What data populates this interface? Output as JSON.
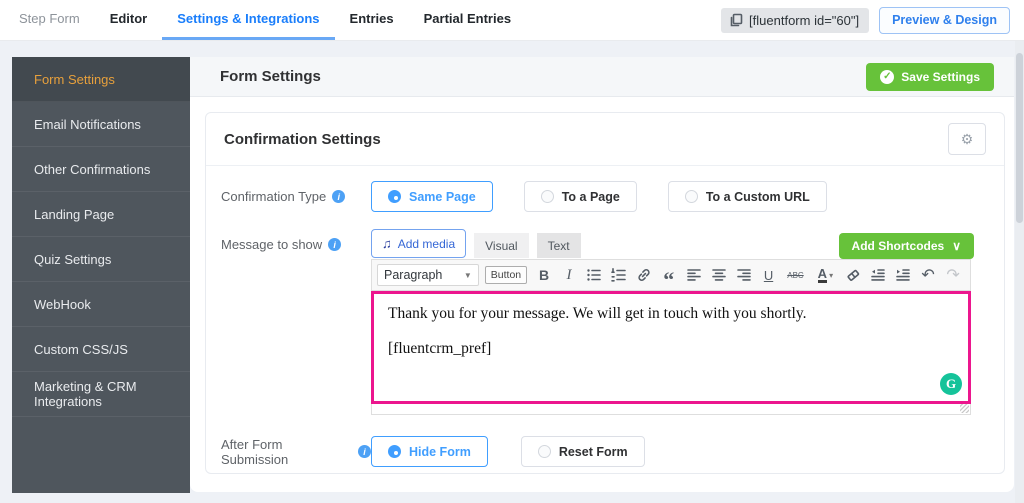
{
  "topbar": {
    "tabs": [
      {
        "label": "Step Form",
        "active": false
      },
      {
        "label": "Editor",
        "active": false
      },
      {
        "label": "Settings & Integrations",
        "active": true
      },
      {
        "label": "Entries",
        "active": false
      },
      {
        "label": "Partial Entries",
        "active": false
      }
    ],
    "shortcode": "[fluentform id=\"60\"]",
    "preview_button": "Preview & Design"
  },
  "sidebar": {
    "items": [
      {
        "label": "Form Settings",
        "active": true
      },
      {
        "label": "Email Notifications",
        "active": false
      },
      {
        "label": "Other Confirmations",
        "active": false
      },
      {
        "label": "Landing Page",
        "active": false
      },
      {
        "label": "Quiz Settings",
        "active": false
      },
      {
        "label": "WebHook",
        "active": false
      },
      {
        "label": "Custom CSS/JS",
        "active": false
      },
      {
        "label": "Marketing & CRM Integrations",
        "active": false
      }
    ]
  },
  "panel": {
    "title": "Form Settings",
    "save_button": "Save Settings"
  },
  "section": {
    "title": "Confirmation Settings"
  },
  "confirmation_type": {
    "label": "Confirmation Type",
    "options": [
      {
        "label": "Same Page",
        "selected": true
      },
      {
        "label": "To a Page",
        "selected": false
      },
      {
        "label": "To a Custom URL",
        "selected": false
      }
    ]
  },
  "message": {
    "label": "Message to show",
    "add_media_label": "Add media",
    "editor_tabs": [
      {
        "label": "Visual",
        "active": true
      },
      {
        "label": "Text",
        "active": false
      }
    ],
    "add_shortcodes_label": "Add Shortcodes",
    "toolbar": {
      "paragraph_label": "Paragraph",
      "button_label": "Button"
    },
    "content": {
      "line1": "Thank you for your message. We will get in touch with you shortly.",
      "line2": "[fluentcrm_pref]"
    }
  },
  "after_submission": {
    "label": "After Form Submission",
    "options": [
      {
        "label": "Hide Form",
        "selected": true
      },
      {
        "label": "Reset Form",
        "selected": false
      }
    ]
  },
  "icons": {
    "check": "✓",
    "gear": "⚙",
    "music_note": "♫",
    "undo": "↶",
    "redo": "↷",
    "quote": "“",
    "grammarly": "G",
    "dropdown_caret": "∨",
    "select_caret": "▼",
    "caret_small": "▾",
    "info": "i",
    "bold": "B",
    "italic": "I",
    "underline": "U",
    "strike": "ABC",
    "color": "A"
  },
  "colors": {
    "accent_blue": "#1a7efb",
    "element_blue": "#409eff",
    "success_green": "#67c23a",
    "active_orange": "#e7a03c",
    "editor_focus_pink": "#ec168e",
    "grammarly_green": "#15c39a",
    "sidebar_dark": "#4f565d"
  }
}
